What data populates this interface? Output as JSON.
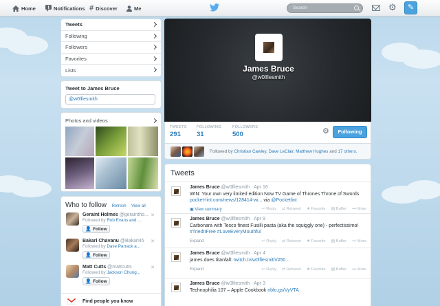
{
  "nav": {
    "home": "Home",
    "notifications": "Notifications",
    "discover": "Discover",
    "me": "Me",
    "search_placeholder": "Search"
  },
  "sidebar": {
    "items": [
      {
        "label": "Tweets"
      },
      {
        "label": "Following"
      },
      {
        "label": "Followers"
      },
      {
        "label": "Favorites"
      },
      {
        "label": "Lists"
      }
    ]
  },
  "tweet_to": {
    "title": "Tweet to James Bruce",
    "value": "@w0lfiesmith"
  },
  "photos": {
    "title": "Photos and videos"
  },
  "who_to_follow": {
    "title": "Who to follow",
    "refresh": "Refresh",
    "view_all": "View all",
    "follow_label": "Follow",
    "people": [
      {
        "name": "Geraint Holmes",
        "handle": "@geraintho...",
        "followed_by_prefix": "Followed by",
        "followed_by": "Rob Evans and ..."
      },
      {
        "name": "Bakari Chavanu",
        "handle": "@Bakari45",
        "followed_by_prefix": "Followed by",
        "followed_by": "Dave Parrack a..."
      },
      {
        "name": "Matt Cutts",
        "handle": "@mattcutts",
        "followed_by_prefix": "Followed by",
        "followed_by": "Jackson Chung..."
      }
    ],
    "find_people": "Find people you know"
  },
  "profile": {
    "name": "James Bruce",
    "handle": "@w0lfiesmith",
    "stats": [
      {
        "label": "TWEETS",
        "value": "291"
      },
      {
        "label": "FOLLOWING",
        "value": "31"
      },
      {
        "label": "FOLLOWERS",
        "value": "500"
      }
    ],
    "following_button": "Following",
    "followed_by_prefix": "Followed by",
    "followed_by_names": [
      "Christian Cawley",
      "Dave LeClair",
      "Matthew Hughes"
    ],
    "followed_by_and": "and",
    "followed_by_others": "17 others."
  },
  "tweets": {
    "header": "Tweets",
    "actions": {
      "reply": "Reply",
      "retweet": "Retweet",
      "favorite": "Favorite",
      "buffer": "Buffer",
      "more": "More"
    },
    "items": [
      {
        "name": "James Bruce",
        "handle": "@w0lfiesmith",
        "date": "Apr 16",
        "text": "WIN: Your own very limited edition Now TV Game of Thrones Throne of Swords",
        "link": "pocket-lint.com/news/128414-wi...",
        "via": "via",
        "via_handle": "@Pocketlint",
        "expand": "View summary"
      },
      {
        "name": "James Bruce",
        "handle": "@w0lfiesmith",
        "date": "Apr 9",
        "text": "Carbonara with Tesco finest Fusilli pasta (aka the squiggly one) - perfectissimo!",
        "tags": "#TriedItFree #LoveEveryMouthful",
        "expand": "Expand"
      },
      {
        "name": "James Bruce",
        "handle": "@w0lfiesmith",
        "date": "Apr 4",
        "text": "james does titanfall:",
        "link": "twitch.tv/w0lfiesmith/#50...",
        "expand": "Expand"
      },
      {
        "name": "James Bruce",
        "handle": "@w0lfiesmith",
        "date": "Apr 3",
        "text": "Technophilia 107 – Apple Cookbook",
        "link": "nblo.gs/VyVTA",
        "expand": ""
      }
    ]
  }
}
